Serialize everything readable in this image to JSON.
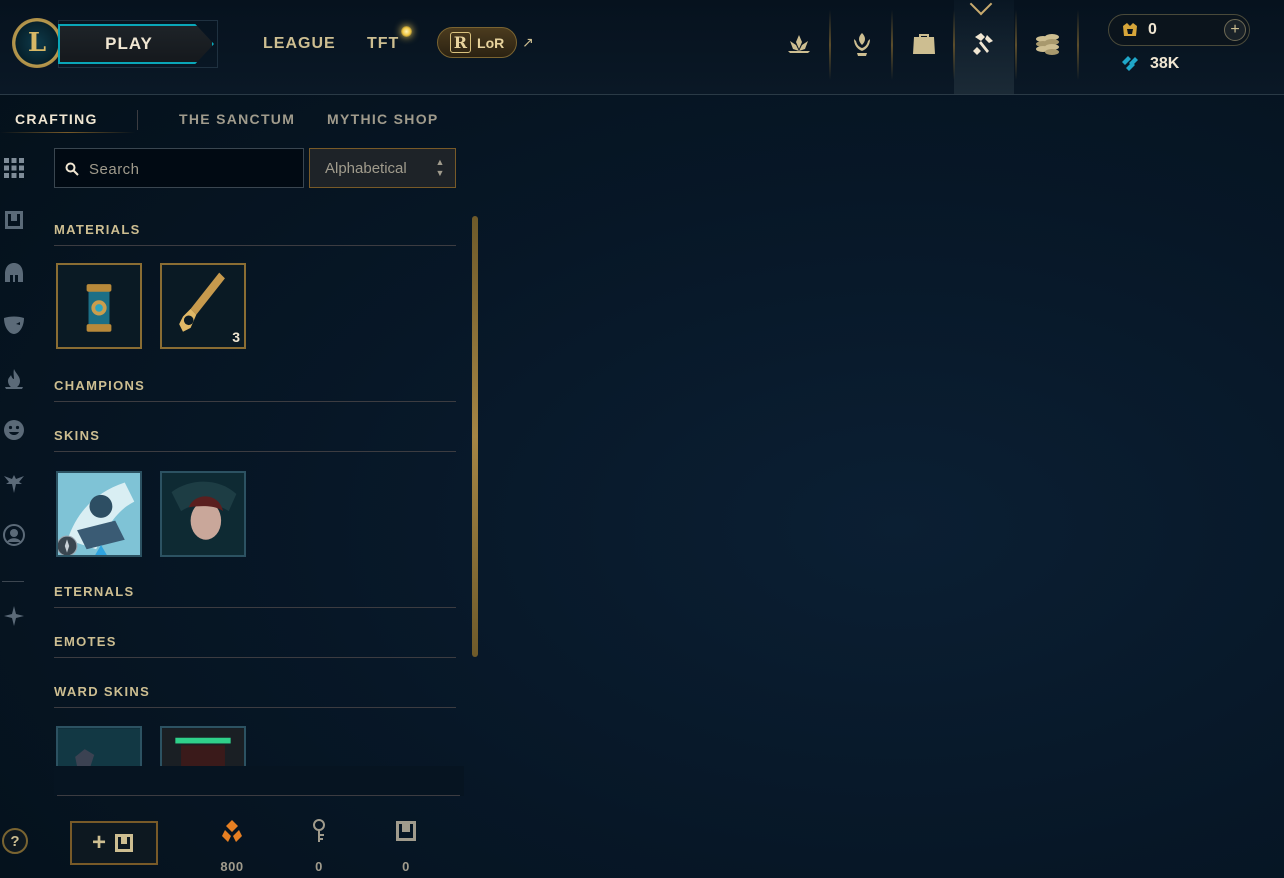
{
  "header": {
    "play_label": "PLAY",
    "nav": [
      {
        "label": "LEAGUE"
      },
      {
        "label": "TFT"
      }
    ],
    "lor_label": "LoR",
    "rp_value": "0",
    "blue_essence_value": "38K",
    "active_icon": "loot-hextech-icon",
    "icons": [
      "crest-icon",
      "champions-icon",
      "inventory-bag-icon",
      "loot-hextech-icon",
      "store-coins-icon"
    ]
  },
  "subnav": {
    "tabs": [
      {
        "label": "CRAFTING",
        "active": true
      },
      {
        "label": "THE SANCTUM",
        "active": false
      },
      {
        "label": "MYTHIC SHOP",
        "active": false
      }
    ]
  },
  "toolbar": {
    "search_placeholder": "Search",
    "sort_label": "Alphabetical"
  },
  "sections": {
    "materials": {
      "title": "MATERIALS",
      "items": [
        {
          "name": "chest-icon",
          "count": ""
        },
        {
          "name": "key-icon",
          "count": "3"
        }
      ]
    },
    "champions": {
      "title": "CHAMPIONS"
    },
    "skins": {
      "title": "SKINS"
    },
    "eternals": {
      "title": "ETERNALS"
    },
    "emotes": {
      "title": "EMOTES"
    },
    "ward_skins": {
      "title": "WARD SKINS"
    }
  },
  "footer": {
    "orange_essence": "800",
    "key_fragments": "0",
    "chests": "0"
  },
  "colors": {
    "gold": "#c8aa6e",
    "teal": "#0aa6b8",
    "background": "#071727"
  }
}
